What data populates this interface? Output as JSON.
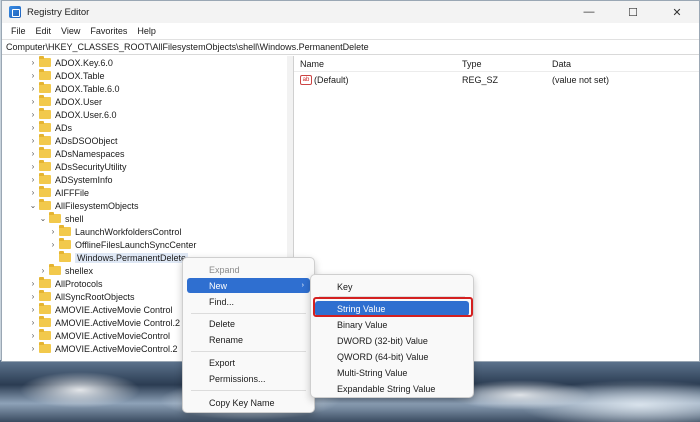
{
  "window": {
    "title": "Registry Editor",
    "controls": {
      "minimize": "—",
      "maximize": "☐",
      "close": "✕"
    }
  },
  "menu": [
    "File",
    "Edit",
    "View",
    "Favorites",
    "Help"
  ],
  "address": "Computer\\HKEY_CLASSES_ROOT\\AllFilesystemObjects\\shell\\Windows.PermanentDelete",
  "tree": {
    "items": [
      {
        "label": "ADOX.Key.6.0",
        "chevron": "›"
      },
      {
        "label": "ADOX.Table",
        "chevron": "›"
      },
      {
        "label": "ADOX.Table.6.0",
        "chevron": "›"
      },
      {
        "label": "ADOX.User",
        "chevron": "›"
      },
      {
        "label": "ADOX.User.6.0",
        "chevron": "›"
      },
      {
        "label": "ADs",
        "chevron": "›"
      },
      {
        "label": "ADsDSOObject",
        "chevron": "›"
      },
      {
        "label": "ADsNamespaces",
        "chevron": "›"
      },
      {
        "label": "ADsSecurityUtility",
        "chevron": "›"
      },
      {
        "label": "ADSystemInfo",
        "chevron": "›"
      },
      {
        "label": "AIFFFile",
        "chevron": "›"
      },
      {
        "label": "AllFilesystemObjects",
        "chevron": "⌄"
      },
      {
        "label": "shell",
        "chevron": "⌄"
      },
      {
        "label": "LaunchWorkfoldersControl",
        "chevron": "›"
      },
      {
        "label": "OfflineFilesLaunchSyncCenter",
        "chevron": "›"
      },
      {
        "label": "Windows.PermanentDelete",
        "chevron": ""
      },
      {
        "label": "shellex",
        "chevron": "›"
      },
      {
        "label": "AllProtocols",
        "chevron": "›"
      },
      {
        "label": "AllSyncRootObjects",
        "chevron": "›"
      },
      {
        "label": "AMOVIE.ActiveMovie Control",
        "chevron": "›"
      },
      {
        "label": "AMOVIE.ActiveMovie Control.2",
        "chevron": "›"
      },
      {
        "label": "AMOVIE.ActiveMovieControl",
        "chevron": "›"
      },
      {
        "label": "AMOVIE.ActiveMovieControl.2",
        "chevron": "›"
      }
    ]
  },
  "values_pane": {
    "headers": {
      "name": "Name",
      "type": "Type",
      "data": "Data"
    },
    "rows": [
      {
        "icon": "ab",
        "name": "(Default)",
        "type": "REG_SZ",
        "data": "(value not set)"
      }
    ]
  },
  "context_menu": {
    "expand": "Expand",
    "new": "New",
    "new_arrow": "›",
    "find": "Find...",
    "delete": "Delete",
    "rename": "Rename",
    "export": "Export",
    "permissions": "Permissions...",
    "copy_key_name": "Copy Key Name"
  },
  "submenu": {
    "items": [
      "Key",
      "String Value",
      "Binary Value",
      "DWORD (32-bit) Value",
      "QWORD (64-bit) Value",
      "Multi-String Value",
      "Expandable String Value"
    ]
  },
  "colors": {
    "accent": "#2f6fd0",
    "highlight_border": "#d42020",
    "folder": "#f2c94c"
  }
}
